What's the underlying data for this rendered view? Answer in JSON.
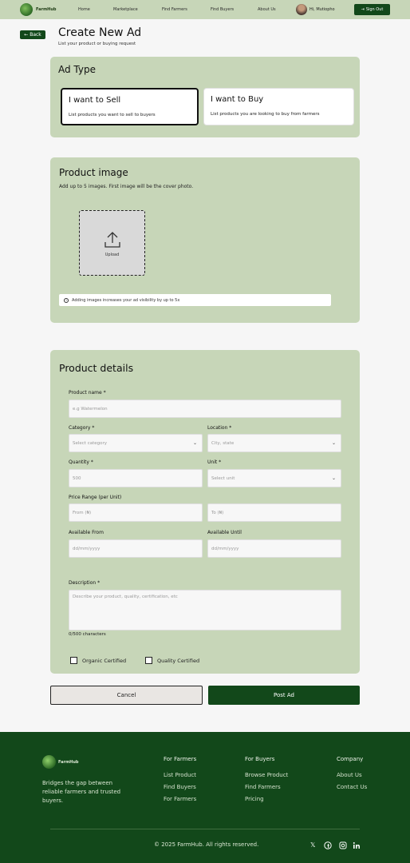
{
  "nav": {
    "brand": "FarmHub",
    "links": [
      "Home",
      "Marketplace",
      "Find Farmers",
      "Find Buyers",
      "About Us"
    ],
    "user_greeting": "Hi, Mutiopho",
    "sign_out": "Sign Out"
  },
  "header": {
    "back_label": "Back",
    "title": "Create New Ad",
    "subtitle": "List your product or buying request"
  },
  "ad_type": {
    "heading": "Ad Type",
    "options": [
      {
        "title": "I want to Sell",
        "desc": "List products you want to sell to buyers",
        "selected": true
      },
      {
        "title": "I want to Buy",
        "desc": "List products you are looking to buy from farmers",
        "selected": false
      }
    ]
  },
  "images": {
    "heading": "Product image",
    "hint": "Add up to 5 images. First image will be the cover photo.",
    "upload_label": "Upload",
    "tip": "Adding images increases your ad visibility by up to 5x"
  },
  "details": {
    "heading": "Product details",
    "product_name": {
      "label": "Product name *",
      "placeholder": "e.g Watermelon"
    },
    "category": {
      "label": "Category *",
      "placeholder": "Select category"
    },
    "location": {
      "label": "Location *",
      "placeholder": "City, state"
    },
    "quantity": {
      "label": "Quantity *",
      "placeholder": "500"
    },
    "unit": {
      "label": "Unit *",
      "placeholder": "Select unit"
    },
    "price_range": {
      "label": "Price Range (per Unit)",
      "from_placeholder": "From (₦)",
      "to_placeholder": "To (₦)"
    },
    "available_from": {
      "label": "Available From",
      "placeholder": "dd/mm/yyyy"
    },
    "available_until": {
      "label": "Available Until",
      "placeholder": "dd/mm/yyyy"
    },
    "description": {
      "label": "Description *",
      "placeholder": "Describe your product, quality, certification, etc",
      "counter": "0/500 characters"
    },
    "checkboxes": [
      "Organic Certified",
      "Quality Certified"
    ]
  },
  "actions": {
    "cancel": "Cancel",
    "post": "Post Ad"
  },
  "footer": {
    "brand": "FarmHub",
    "tagline": "Bridges the gap between reliable farmers and trusted buyers.",
    "columns": [
      {
        "heading": "For Farmers",
        "links": [
          "List Product",
          "Find Buyers",
          "For Farmers"
        ]
      },
      {
        "heading": "For Buyers",
        "links": [
          "Browse Product",
          "Find Farmers",
          "Pricing"
        ]
      },
      {
        "heading": "Company",
        "links": [
          "About Us",
          "Contact Us"
        ]
      }
    ],
    "copyright": "© 2025 FarmHub. All rights reserved.",
    "social_icons": [
      "x-icon",
      "facebook-icon",
      "instagram-icon",
      "linkedin-icon"
    ]
  },
  "colors": {
    "brand_green": "#12481a",
    "panel_green": "#c7d6b8",
    "page_bg": "#f6f6f6"
  }
}
